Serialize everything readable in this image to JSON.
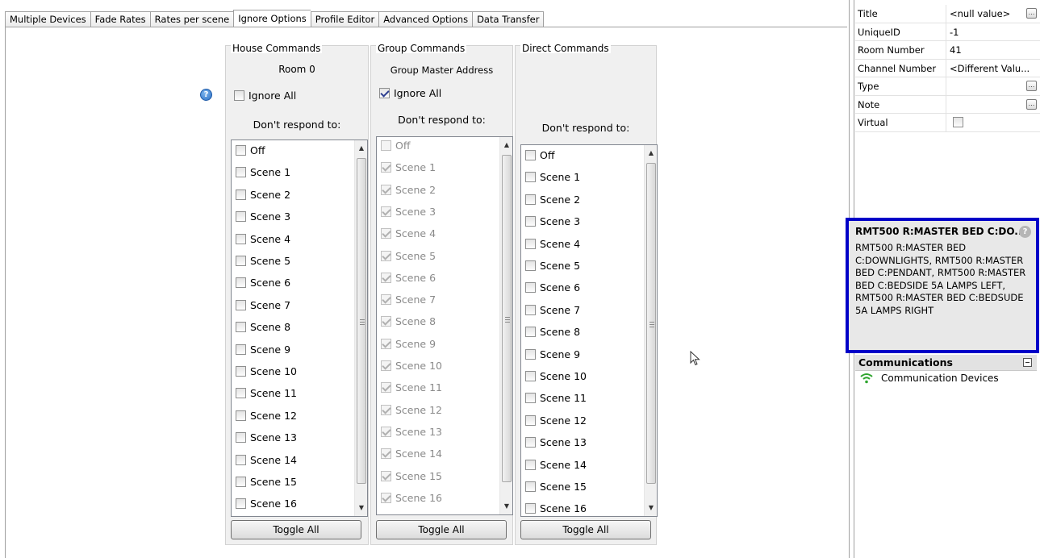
{
  "tabs": [
    {
      "label": "Multiple Devices"
    },
    {
      "label": "Fade Rates"
    },
    {
      "label": "Rates per scene"
    },
    {
      "label": "Ignore Options",
      "active": true
    },
    {
      "label": "Profile Editor"
    },
    {
      "label": "Advanced Options"
    },
    {
      "label": "Data Transfer"
    }
  ],
  "help_icon": "help-icon",
  "house": {
    "title": "House Commands",
    "subtitle": "Room 0",
    "ignore_all_label": "Ignore All",
    "ignore_all_checked": false,
    "dont_respond": "Don't respond to:",
    "items": [
      "Off",
      "Scene 1",
      "Scene 2",
      "Scene 3",
      "Scene 4",
      "Scene 5",
      "Scene 6",
      "Scene 7",
      "Scene 8",
      "Scene 9",
      "Scene 10",
      "Scene 11",
      "Scene 12",
      "Scene 13",
      "Scene 14",
      "Scene 15",
      "Scene 16"
    ],
    "toggle_all": "Toggle All"
  },
  "group": {
    "title": "Group Commands",
    "subtitle": "Group Master Address",
    "ignore_all_label": "Ignore All",
    "ignore_all_checked": true,
    "dont_respond": "Don't respond to:",
    "items": [
      "Off",
      "Scene 1",
      "Scene 2",
      "Scene 3",
      "Scene 4",
      "Scene 5",
      "Scene 6",
      "Scene 7",
      "Scene 8",
      "Scene 9",
      "Scene 10",
      "Scene 11",
      "Scene 12",
      "Scene 13",
      "Scene 14",
      "Scene 15",
      "Scene 16"
    ],
    "toggle_all": "Toggle All"
  },
  "direct": {
    "title": "Direct Commands",
    "dont_respond": "Don't respond to:",
    "items": [
      "Off",
      "Scene 1",
      "Scene 2",
      "Scene 3",
      "Scene 4",
      "Scene 5",
      "Scene 6",
      "Scene 7",
      "Scene 8",
      "Scene 9",
      "Scene 10",
      "Scene 11",
      "Scene 12",
      "Scene 13",
      "Scene 14",
      "Scene 15",
      "Scene 16"
    ],
    "toggle_all": "Toggle All"
  },
  "properties": [
    {
      "name": "Title",
      "value": "<null value>",
      "button": true
    },
    {
      "name": "UniqueID",
      "value": "-1"
    },
    {
      "name": "Room Number",
      "value": "41"
    },
    {
      "name": "Channel Number",
      "value": "<Different Valu..."
    },
    {
      "name": "Type",
      "value": "",
      "button": true
    },
    {
      "name": "Note",
      "value": "",
      "button": true
    },
    {
      "name": "Virtual",
      "value": "",
      "checkbox": true
    }
  ],
  "info": {
    "title": "RMT500 R:MASTER BED C:DO...",
    "text": "RMT500 R:MASTER BED C:DOWNLIGHTS, RMT500 R:MASTER BED C:PENDANT, RMT500 R:MASTER BED C:BEDSIDE 5A LAMPS LEFT, RMT500 R:MASTER BED C:BEDSUDE 5A LAMPS RIGHT"
  },
  "communications": {
    "header": "Communications",
    "item": "Communication Devices",
    "icon": "wifi-icon"
  },
  "colors": {
    "highlight_border": "#0000c8",
    "panel_bg": "#f0f0f0"
  }
}
